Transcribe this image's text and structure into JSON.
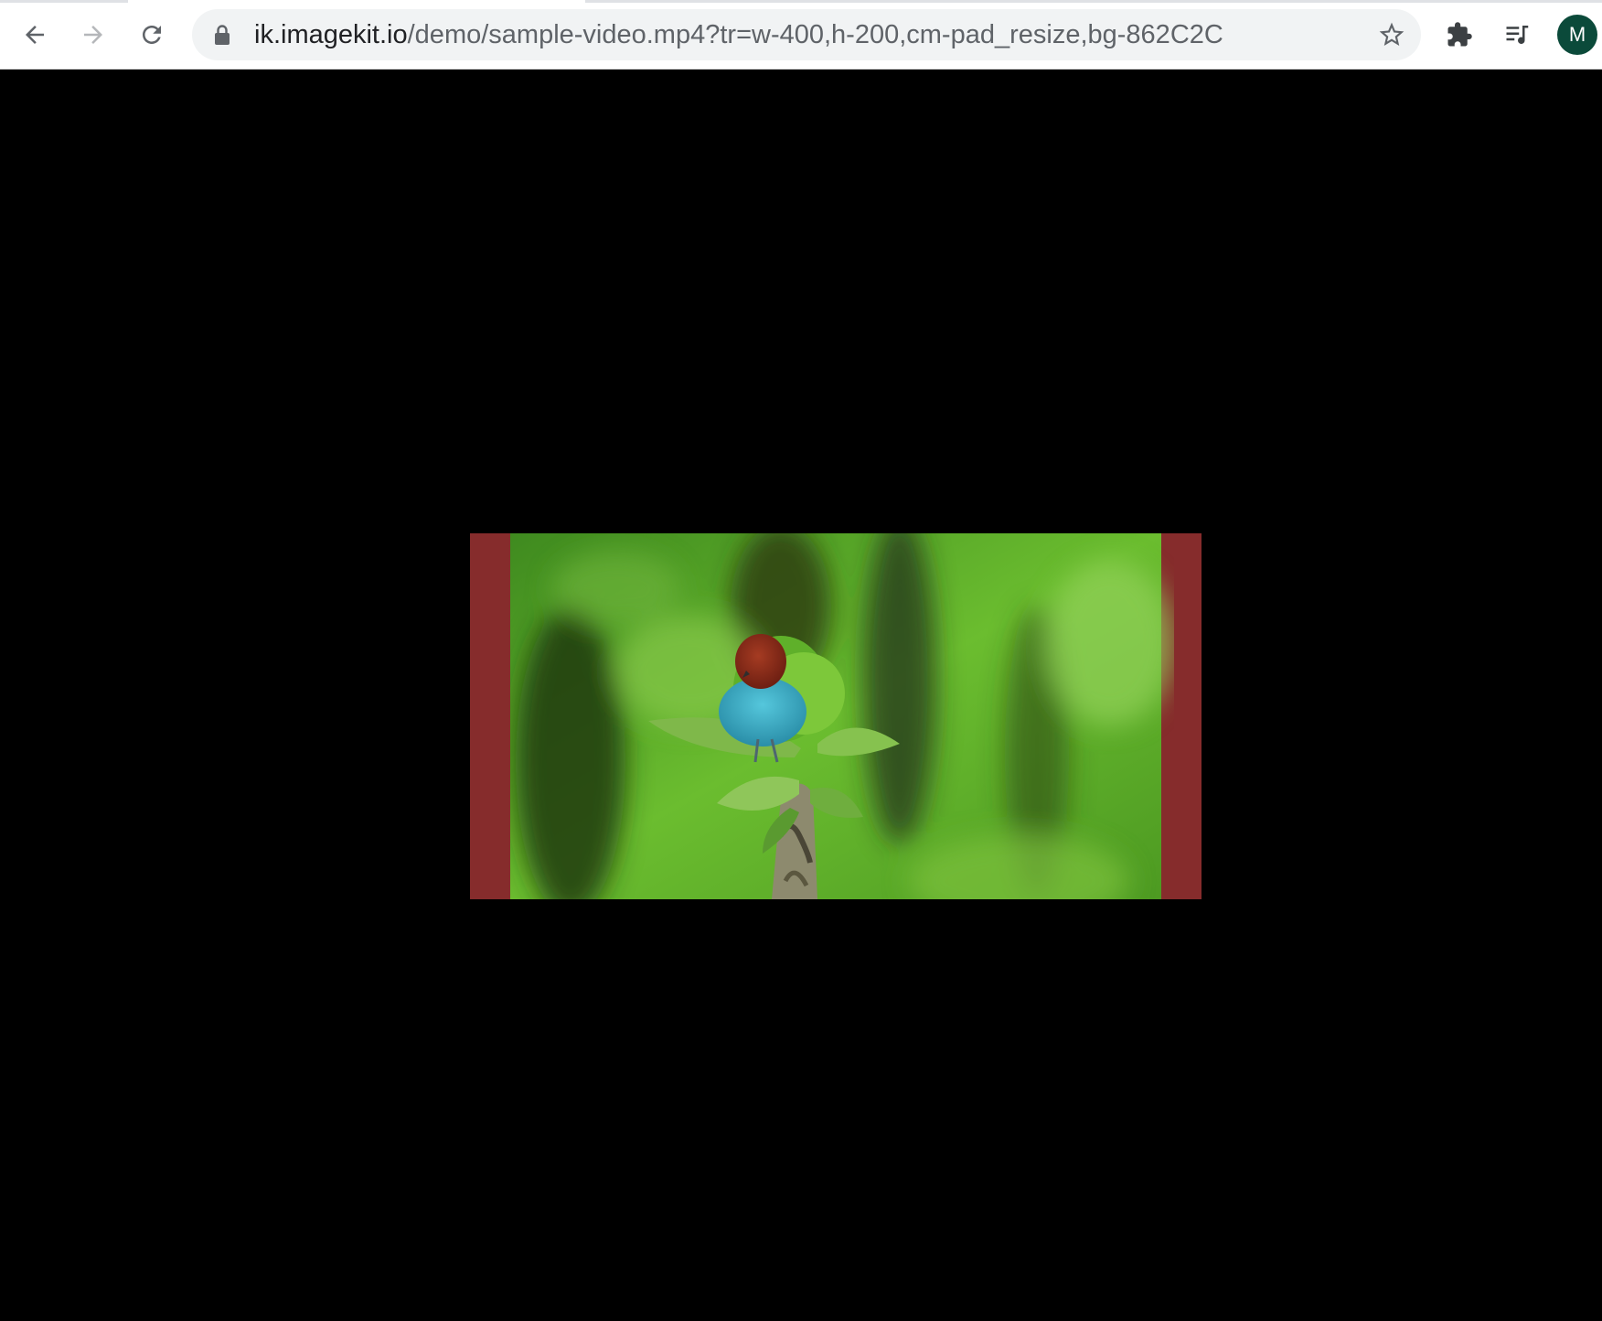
{
  "browser": {
    "url_host": "ik.imagekit.io",
    "url_path": "/demo/sample-video.mp4?tr=w-400,h-200,cm-pad_resize,bg-862C2C",
    "profile_initial": "M",
    "icons": {
      "back": "arrow-left-icon",
      "forward": "arrow-right-icon",
      "reload": "reload-icon",
      "lock": "lock-icon",
      "bookmark": "star-icon",
      "extensions": "puzzle-icon",
      "media": "media-queue-icon"
    }
  },
  "video": {
    "pad_color": "#862C2C",
    "content": "sample-video frame: bird perched on a leafy branch against a blurred green background"
  },
  "colors": {
    "page_background": "#000000",
    "toolbar_background": "#ffffff",
    "omnibox_background": "#f1f3f4",
    "avatar_background": "#0b4a3a"
  }
}
